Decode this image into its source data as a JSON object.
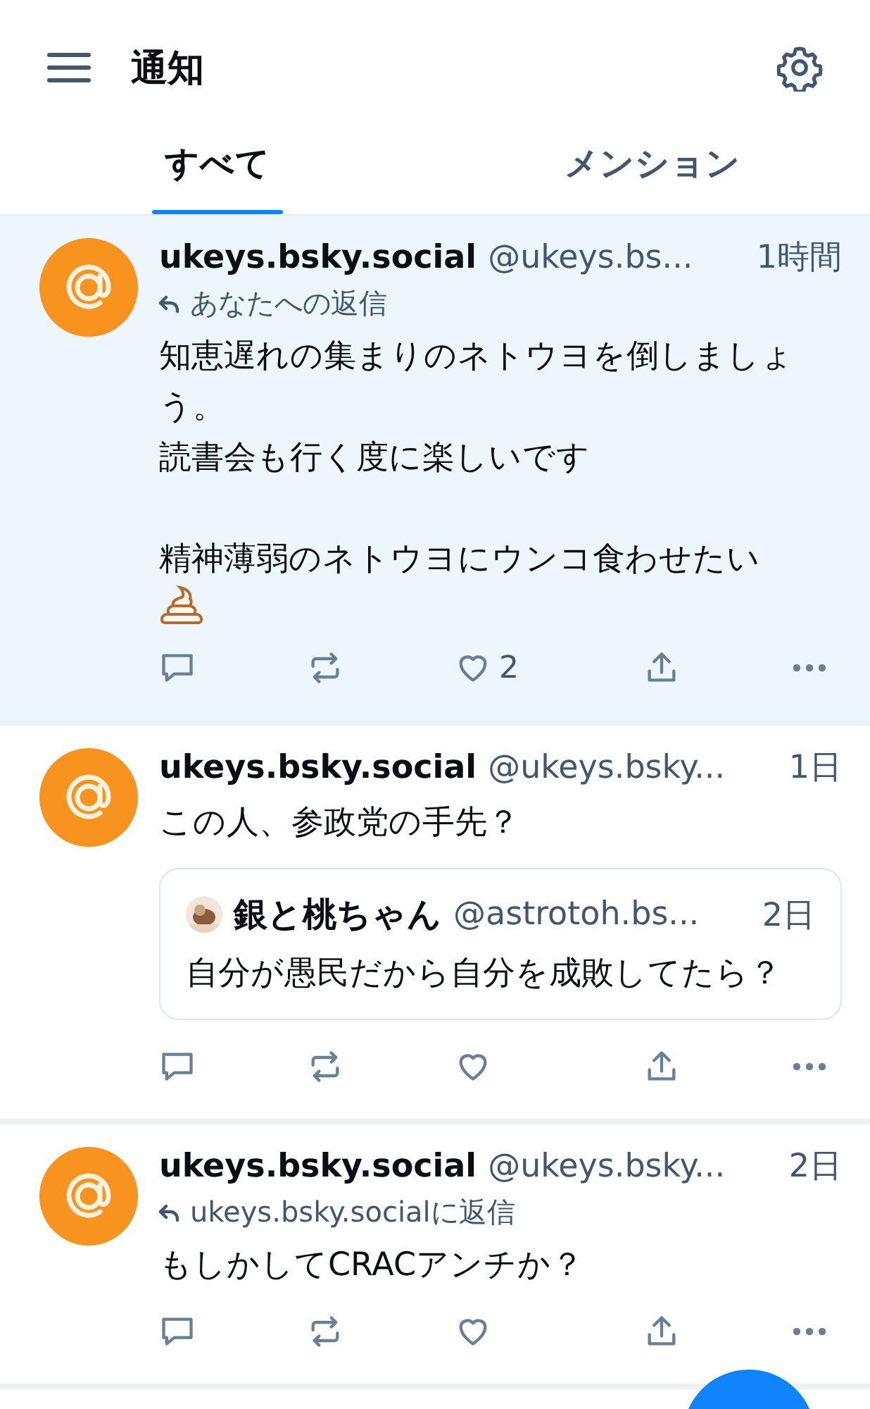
{
  "header": {
    "title": "通知"
  },
  "tabs": [
    {
      "label": "すべて",
      "selected": true
    },
    {
      "label": "メンション",
      "selected": false
    }
  ],
  "posts": [
    {
      "unread": true,
      "name": "ukeys.bsky.social",
      "handle": "@ukeys.bs...",
      "time": "1時間",
      "reply_to": "あなたへの返信",
      "paragraphs": [
        [
          "知恵遅れの集まりのネトウヨを倒しましょう。",
          "読書会も行く度に楽しいです"
        ],
        [
          "精神薄弱のネトウヨにウンコ食わせたい"
        ]
      ],
      "ends_with_icon": true,
      "like_count": "2"
    },
    {
      "unread": false,
      "name": "ukeys.bsky.social",
      "handle": "@ukeys.bsky...",
      "time": "1日",
      "paragraphs": [
        [
          "この人、参政党の手先？"
        ]
      ],
      "quote": {
        "name": "銀と桃ちゃん",
        "handle": "@astrotoh.bs...",
        "time": "2日",
        "text": "自分が愚民だから自分を成敗してたら？"
      }
    },
    {
      "unread": false,
      "name": "ukeys.bsky.social",
      "handle": "@ukeys.bsky...",
      "time": "2日",
      "reply_to": "ukeys.bsky.socialに返信",
      "paragraphs": [
        [
          "もしかしてCRACアンチか？"
        ]
      ]
    }
  ]
}
